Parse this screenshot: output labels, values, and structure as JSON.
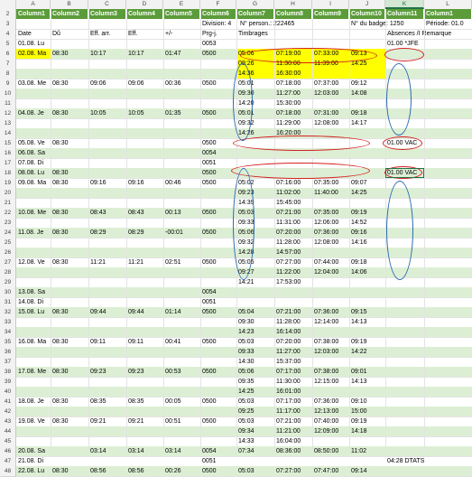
{
  "columns": [
    "A",
    "B",
    "C",
    "D",
    "E",
    "F",
    "G",
    "H",
    "I",
    "J",
    "K",
    "L"
  ],
  "table_headers": [
    "Column1",
    "Column2",
    "Column3",
    "Column4",
    "Column5",
    "Column6",
    "Column7",
    "Column8",
    "Column9",
    "Column10",
    "Column11",
    "Column1"
  ],
  "info": {
    "division": "Division: 4",
    "person": "N° person.: 222465",
    "badge": "N° du badge: 1250",
    "periode": "Période: 01.0"
  },
  "headers": {
    "date": "Date",
    "du": "Dû",
    "eff_arr": "Eff. arr.",
    "eff": "Eff.",
    "diff": "+/-",
    "prg": "Prg-j.",
    "timbrages": "Timbrages",
    "absences": "Absences /I Remarque"
  },
  "rows": [
    {
      "n": "5",
      "a": "01.08. Lu",
      "b": "",
      "c": "",
      "d": "",
      "e": "",
      "f": "0053",
      "g": "",
      "h": "",
      "i": "",
      "j": "",
      "k": "01.00 *JFE",
      "band": false,
      "yellow": false
    },
    {
      "n": "6",
      "a": "02.08. Ma",
      "b": "08:30",
      "c": "10:17",
      "d": "10:17",
      "e": "01:47",
      "f": "0500",
      "g": "05:06",
      "h": "07:19:00",
      "i": "07:33:00",
      "j": "09:13",
      "k": "",
      "band": true,
      "yellow": true
    },
    {
      "n": "7",
      "a": "",
      "b": "",
      "c": "",
      "d": "",
      "e": "",
      "f": "",
      "g": "09:26",
      "h": "11:30:00",
      "i": "11:39:00",
      "j": "14:25",
      "k": "",
      "band": false,
      "yellow": true
    },
    {
      "n": "8",
      "a": "",
      "b": "",
      "c": "",
      "d": "",
      "e": "",
      "f": "",
      "g": "14:36",
      "h": "16:30:00",
      "i": "",
      "j": "",
      "k": "",
      "band": true,
      "yellow": true
    },
    {
      "n": "9",
      "a": "03.08. Me",
      "b": "08:30",
      "c": "09:06",
      "d": "09:06",
      "e": "00:36",
      "f": "0500",
      "g": "05:01",
      "h": "07:18:00",
      "i": "07:37:00",
      "j": "09:12",
      "k": "",
      "band": false,
      "yellow": false
    },
    {
      "n": "10",
      "a": "",
      "b": "",
      "c": "",
      "d": "",
      "e": "",
      "f": "",
      "g": "09:30",
      "h": "11:27:00",
      "i": "12:03:00",
      "j": "14:08",
      "k": "",
      "band": true,
      "yellow": false
    },
    {
      "n": "11",
      "a": "",
      "b": "",
      "c": "",
      "d": "",
      "e": "",
      "f": "",
      "g": "14:20",
      "h": "15:30:00",
      "i": "",
      "j": "",
      "k": "",
      "band": false,
      "yellow": false
    },
    {
      "n": "12",
      "a": "04.08. Je",
      "b": "08:30",
      "c": "10:05",
      "d": "10:05",
      "e": "01:35",
      "f": "0500",
      "g": "05:01",
      "h": "07:18:00",
      "i": "07:31:00",
      "j": "09:18",
      "k": "",
      "band": true,
      "yellow": false
    },
    {
      "n": "13",
      "a": "",
      "b": "",
      "c": "",
      "d": "",
      "e": "",
      "f": "",
      "g": "09:32",
      "h": "11:29:00",
      "i": "12:08:00",
      "j": "14:17",
      "k": "",
      "band": false,
      "yellow": false
    },
    {
      "n": "14",
      "a": "",
      "b": "",
      "c": "",
      "d": "",
      "e": "",
      "f": "",
      "g": "14:26",
      "h": "16:20:00",
      "i": "",
      "j": "",
      "k": "",
      "band": true,
      "yellow": false
    },
    {
      "n": "15",
      "a": "05.08. Ve",
      "b": "08:30",
      "c": "",
      "d": "",
      "e": "",
      "f": "0500",
      "g": "",
      "h": "",
      "i": "",
      "j": "",
      "k": "01.00 VAC",
      "band": false,
      "yellow": false
    },
    {
      "n": "16",
      "a": "06.08. Sa",
      "b": "",
      "c": "",
      "d": "",
      "e": "",
      "f": "0054",
      "g": "",
      "h": "",
      "i": "",
      "j": "",
      "k": "",
      "band": true,
      "yellow": false
    },
    {
      "n": "17",
      "a": "07.08. Di",
      "b": "",
      "c": "",
      "d": "",
      "e": "",
      "f": "0051",
      "g": "",
      "h": "",
      "i": "",
      "j": "",
      "k": "",
      "band": false,
      "yellow": false
    },
    {
      "n": "18",
      "a": "08.08. Lu",
      "b": "08:30",
      "c": "",
      "d": "",
      "e": "",
      "f": "0500",
      "g": "",
      "h": "",
      "i": "",
      "j": "",
      "k": "01.00 VAC",
      "band": true,
      "yellow": false
    },
    {
      "n": "19",
      "a": "09.08. Ma",
      "b": "08:30",
      "c": "09:16",
      "d": "09:16",
      "e": "00:46",
      "f": "0500",
      "g": "05:02",
      "h": "07:16:00",
      "i": "07:35:00",
      "j": "09:07",
      "k": "",
      "band": false,
      "yellow": false
    },
    {
      "n": "20",
      "a": "",
      "b": "",
      "c": "",
      "d": "",
      "e": "",
      "f": "",
      "g": "09:23",
      "h": "11:02:00",
      "i": "11:40:00",
      "j": "14:25",
      "k": "",
      "band": true,
      "yellow": false
    },
    {
      "n": "21",
      "a": "",
      "b": "",
      "c": "",
      "d": "",
      "e": "",
      "f": "",
      "g": "14:39",
      "h": "15:45:00",
      "i": "",
      "j": "",
      "k": "",
      "band": false,
      "yellow": false
    },
    {
      "n": "22",
      "a": "10.08. Me",
      "b": "08:30",
      "c": "08:43",
      "d": "08:43",
      "e": "00:13",
      "f": "0500",
      "g": "05:03",
      "h": "07:21:00",
      "i": "07:35:00",
      "j": "09:19",
      "k": "",
      "band": true,
      "yellow": false
    },
    {
      "n": "23",
      "a": "",
      "b": "",
      "c": "",
      "d": "",
      "e": "",
      "f": "",
      "g": "09:33",
      "h": "11:31:00",
      "i": "12:06:00",
      "j": "14:52",
      "k": "",
      "band": false,
      "yellow": false
    },
    {
      "n": "24",
      "a": "11.08. Je",
      "b": "08:30",
      "c": "08:29",
      "d": "08:29",
      "e": "-00:01",
      "f": "0500",
      "g": "05:06",
      "h": "07:20:00",
      "i": "07:36:00",
      "j": "09:16",
      "k": "",
      "band": true,
      "yellow": false
    },
    {
      "n": "25",
      "a": "",
      "b": "",
      "c": "",
      "d": "",
      "e": "",
      "f": "",
      "g": "09:32",
      "h": "11:28:00",
      "i": "12:08:00",
      "j": "14:16",
      "k": "",
      "band": false,
      "yellow": false
    },
    {
      "n": "26",
      "a": "",
      "b": "",
      "c": "",
      "d": "",
      "e": "",
      "f": "",
      "g": "14:28",
      "h": "14:57:00",
      "i": "",
      "j": "",
      "k": "",
      "band": true,
      "yellow": false
    },
    {
      "n": "27",
      "a": "12.08. Ve",
      "b": "08:30",
      "c": "11:21",
      "d": "11:21",
      "e": "02:51",
      "f": "0500",
      "g": "05:05",
      "h": "07:27:00",
      "i": "07:44:00",
      "j": "09:18",
      "k": "",
      "band": false,
      "yellow": false
    },
    {
      "n": "28",
      "a": "",
      "b": "",
      "c": "",
      "d": "",
      "e": "",
      "f": "",
      "g": "09:27",
      "h": "11:22:00",
      "i": "12:04:00",
      "j": "14:06",
      "k": "",
      "band": true,
      "yellow": false
    },
    {
      "n": "29",
      "a": "",
      "b": "",
      "c": "",
      "d": "",
      "e": "",
      "f": "",
      "g": "14:21",
      "h": "17:53:00",
      "i": "",
      "j": "",
      "k": "",
      "band": false,
      "yellow": false
    },
    {
      "n": "30",
      "a": "13.08. Sa",
      "b": "",
      "c": "",
      "d": "",
      "e": "",
      "f": "0054",
      "g": "",
      "h": "",
      "i": "",
      "j": "",
      "k": "",
      "band": true,
      "yellow": false
    },
    {
      "n": "31",
      "a": "14.08. Di",
      "b": "",
      "c": "",
      "d": "",
      "e": "",
      "f": "0051",
      "g": "",
      "h": "",
      "i": "",
      "j": "",
      "k": "",
      "band": false,
      "yellow": false
    },
    {
      "n": "32",
      "a": "15.08. Lu",
      "b": "08:30",
      "c": "09:44",
      "d": "09:44",
      "e": "01:14",
      "f": "0500",
      "g": "05:04",
      "h": "07:21:00",
      "i": "07:36:00",
      "j": "09:15",
      "k": "",
      "band": true,
      "yellow": false
    },
    {
      "n": "33",
      "a": "",
      "b": "",
      "c": "",
      "d": "",
      "e": "",
      "f": "",
      "g": "09:30",
      "h": "11:28:00",
      "i": "12:14:00",
      "j": "14:13",
      "k": "",
      "band": false,
      "yellow": false
    },
    {
      "n": "34",
      "a": "",
      "b": "",
      "c": "",
      "d": "",
      "e": "",
      "f": "",
      "g": "14:23",
      "h": "16:14:00",
      "i": "",
      "j": "",
      "k": "",
      "band": true,
      "yellow": false
    },
    {
      "n": "35",
      "a": "16.08. Ma",
      "b": "08:30",
      "c": "09:11",
      "d": "09:11",
      "e": "00:41",
      "f": "0500",
      "g": "05:03",
      "h": "07:20:00",
      "i": "07:38:00",
      "j": "09:19",
      "k": "",
      "band": false,
      "yellow": false
    },
    {
      "n": "36",
      "a": "",
      "b": "",
      "c": "",
      "d": "",
      "e": "",
      "f": "",
      "g": "09:33",
      "h": "11:27:00",
      "i": "12:03:00",
      "j": "14:22",
      "k": "",
      "band": true,
      "yellow": false
    },
    {
      "n": "37",
      "a": "",
      "b": "",
      "c": "",
      "d": "",
      "e": "",
      "f": "",
      "g": "14:30",
      "h": "15:37:00",
      "i": "",
      "j": "",
      "k": "",
      "band": false,
      "yellow": false
    },
    {
      "n": "38",
      "a": "17.08. Me",
      "b": "08:30",
      "c": "09:23",
      "d": "09:23",
      "e": "00:53",
      "f": "0500",
      "g": "05:06",
      "h": "07:17:00",
      "i": "07:38:00",
      "j": "09:01",
      "k": "",
      "band": true,
      "yellow": false
    },
    {
      "n": "39",
      "a": "",
      "b": "",
      "c": "",
      "d": "",
      "e": "",
      "f": "",
      "g": "09:35",
      "h": "11:30:00",
      "i": "12:15:00",
      "j": "14:13",
      "k": "",
      "band": false,
      "yellow": false
    },
    {
      "n": "40",
      "a": "",
      "b": "",
      "c": "",
      "d": "",
      "e": "",
      "f": "",
      "g": "14:25",
      "h": "16:01:00",
      "i": "",
      "j": "",
      "k": "",
      "band": true,
      "yellow": false
    },
    {
      "n": "41",
      "a": "18.08. Je",
      "b": "08:30",
      "c": "08:35",
      "d": "08:35",
      "e": "00:05",
      "f": "0500",
      "g": "05:03",
      "h": "07:17:00",
      "i": "07:36:00",
      "j": "09:10",
      "k": "",
      "band": false,
      "yellow": false
    },
    {
      "n": "42",
      "a": "",
      "b": "",
      "c": "",
      "d": "",
      "e": "",
      "f": "",
      "g": "09:25",
      "h": "11:17:00",
      "i": "12:13:00",
      "j": "15:00",
      "k": "",
      "band": true,
      "yellow": false
    },
    {
      "n": "43",
      "a": "19.08. Ve",
      "b": "08:30",
      "c": "09:21",
      "d": "09:21",
      "e": "00:51",
      "f": "0500",
      "g": "05:03",
      "h": "07:21:00",
      "i": "07:40:00",
      "j": "09:19",
      "k": "",
      "band": false,
      "yellow": false
    },
    {
      "n": "44",
      "a": "",
      "b": "",
      "c": "",
      "d": "",
      "e": "",
      "f": "",
      "g": "09:34",
      "h": "11:21:00",
      "i": "12:09:00",
      "j": "14:18",
      "k": "",
      "band": true,
      "yellow": false
    },
    {
      "n": "45",
      "a": "",
      "b": "",
      "c": "",
      "d": "",
      "e": "",
      "f": "",
      "g": "14:33",
      "h": "16:04:00",
      "i": "",
      "j": "",
      "k": "",
      "band": false,
      "yellow": false
    },
    {
      "n": "46",
      "a": "20.08. Sa",
      "b": "",
      "c": "03:14",
      "d": "03:14",
      "e": "03:14",
      "f": "0054",
      "g": "07:34",
      "h": "08:36:00",
      "i": "08:50:00",
      "j": "11:02",
      "k": "",
      "band": true,
      "yellow": false
    },
    {
      "n": "47",
      "a": "21.08. Di",
      "b": "",
      "c": "",
      "d": "",
      "e": "",
      "f": "0051",
      "g": "",
      "h": "",
      "i": "",
      "j": "",
      "k": "04:28 DTATS",
      "band": false,
      "yellow": false
    },
    {
      "n": "48",
      "a": "22.08. Lu",
      "b": "08:30",
      "c": "08:56",
      "d": "08:56",
      "e": "00:26",
      "f": "0500",
      "g": "05:03",
      "h": "07:27:00",
      "i": "07:47:00",
      "j": "09:14",
      "k": "",
      "band": true,
      "yellow": false
    }
  ]
}
